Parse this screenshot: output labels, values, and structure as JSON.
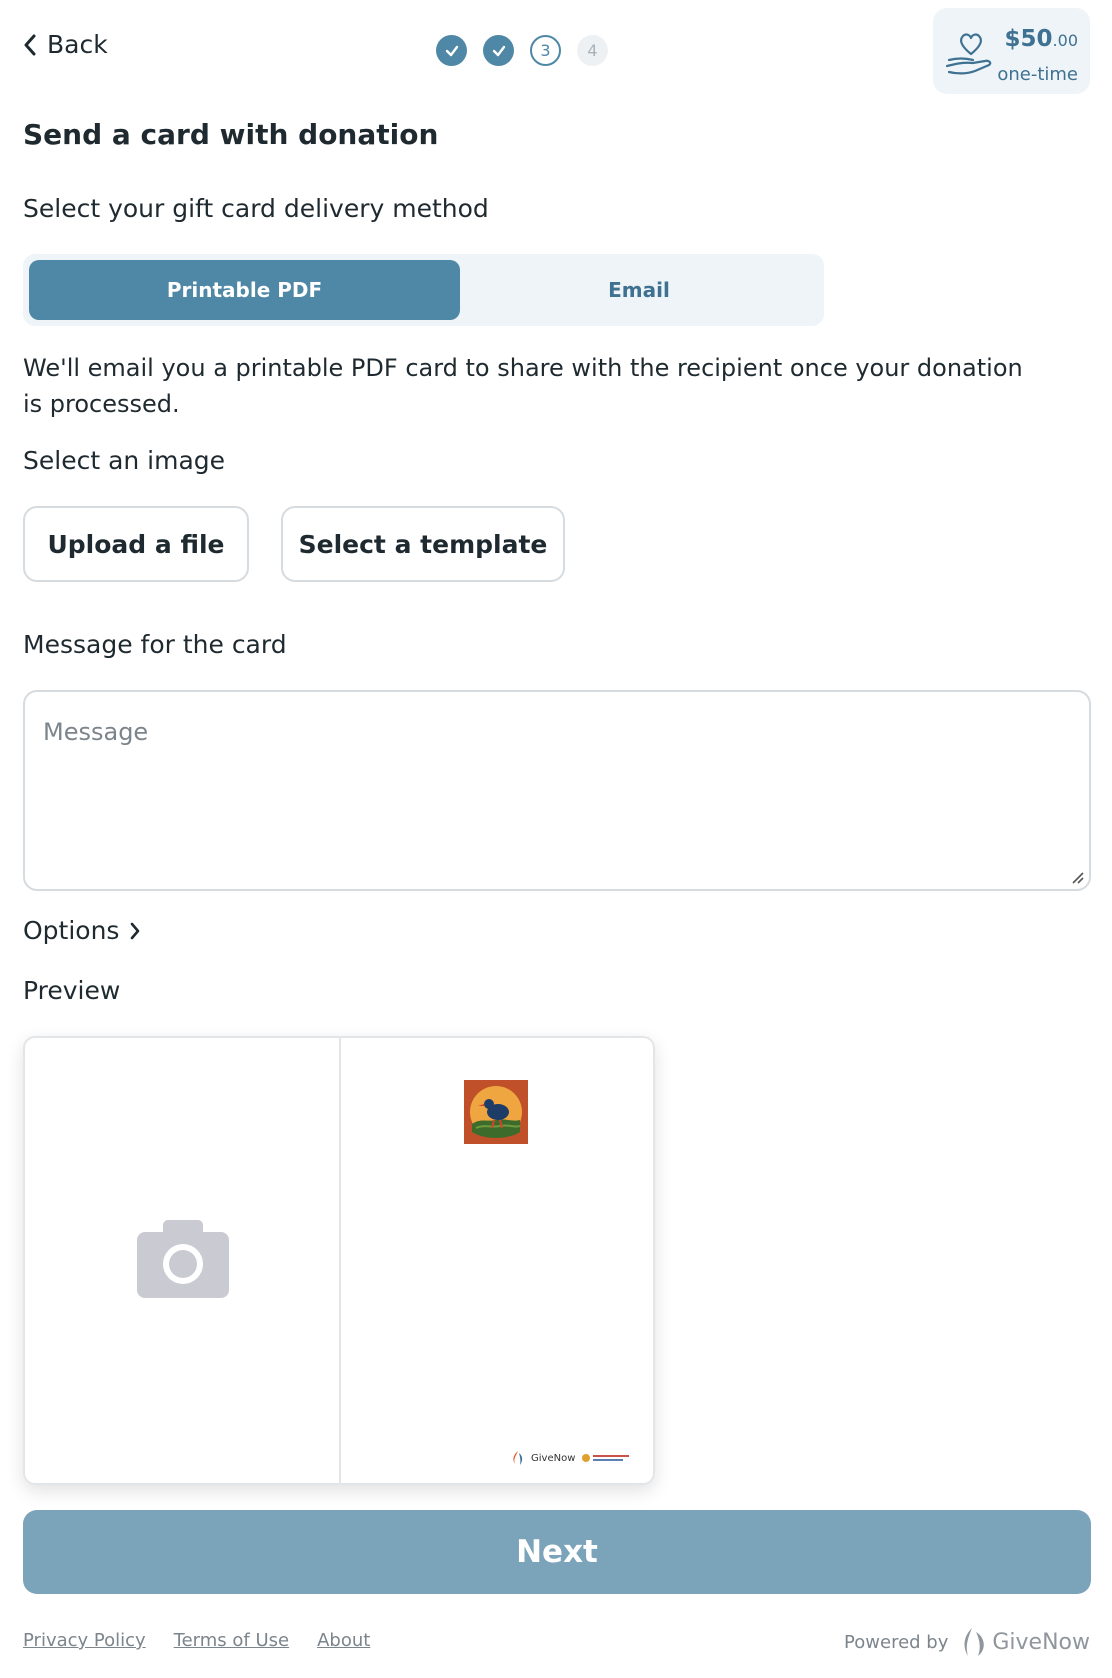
{
  "nav": {
    "back_label": "Back",
    "steps": [
      {
        "state": "done",
        "label": ""
      },
      {
        "state": "done",
        "label": ""
      },
      {
        "state": "current",
        "label": "3"
      },
      {
        "state": "future",
        "label": "4"
      }
    ]
  },
  "donation": {
    "amount": "$50",
    "cents": ".00",
    "frequency": "one-time",
    "icon": "hand-heart-icon"
  },
  "page": {
    "title": "Send a card with donation",
    "delivery_heading": "Select your gift card delivery method",
    "delivery_options": [
      "Printable PDF",
      "Email"
    ],
    "delivery_selected": "Printable PDF",
    "delivery_description": "We'll email you a printable PDF card to share with the recipient once your donation is processed.",
    "image_heading": "Select an image",
    "upload_label": "Upload a file",
    "template_label": "Select a template",
    "message_heading": "Message for the card",
    "message_placeholder": "Message",
    "options_label": "Options",
    "preview_heading": "Preview"
  },
  "preview": {
    "brand_text": "GiveNow"
  },
  "actions": {
    "next_label": "Next"
  },
  "footer": {
    "links": [
      "Privacy Policy",
      "Terms of Use",
      "About"
    ],
    "powered_by": "Powered by",
    "brand": "GiveNow"
  },
  "colors": {
    "accent": "#4f87a6",
    "accent_light": "#eef4f7",
    "next_button": "#7ba3b9"
  }
}
